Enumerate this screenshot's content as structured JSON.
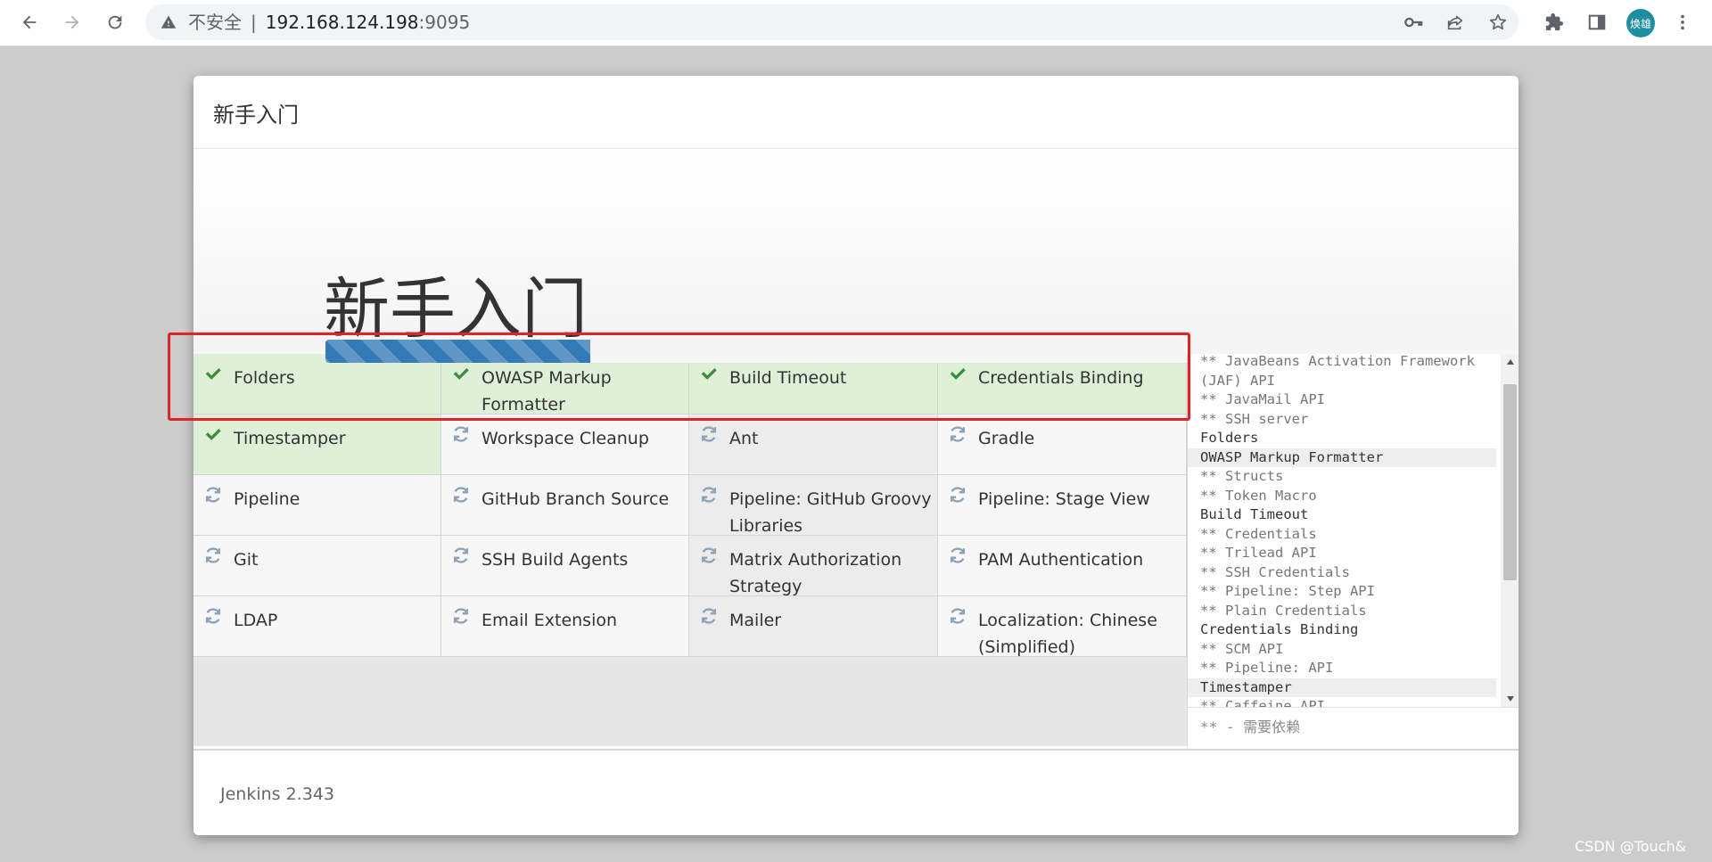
{
  "browser": {
    "security_label": "不安全",
    "separator": "|",
    "host": "192.168.124.198",
    "port": ":9095",
    "avatar_text": "焕雄",
    "icons": [
      "back-icon",
      "forward-icon",
      "reload-icon",
      "warning-icon",
      "key-icon",
      "share-icon",
      "star-icon",
      "extensions-icon",
      "side-panel-icon",
      "menu-icon"
    ]
  },
  "dialog": {
    "header_title": "新手入门",
    "hero_title": "新手入门",
    "progress_percent": 25,
    "version": "Jenkins 2.343"
  },
  "plugins": [
    {
      "name": "Folders",
      "status": "installed"
    },
    {
      "name": "OWASP Markup Formatter",
      "status": "installed"
    },
    {
      "name": "Build Timeout",
      "status": "installed"
    },
    {
      "name": "Credentials Binding",
      "status": "installed"
    },
    {
      "name": "Timestamper",
      "status": "installed"
    },
    {
      "name": "Workspace Cleanup",
      "status": "pending"
    },
    {
      "name": "Ant",
      "status": "pending"
    },
    {
      "name": "Gradle",
      "status": "pending"
    },
    {
      "name": "Pipeline",
      "status": "pending"
    },
    {
      "name": "GitHub Branch Source",
      "status": "pending"
    },
    {
      "name": "Pipeline: GitHub Groovy Libraries",
      "status": "pending"
    },
    {
      "name": "Pipeline: Stage View",
      "status": "pending"
    },
    {
      "name": "Git",
      "status": "pending"
    },
    {
      "name": "SSH Build Agents",
      "status": "pending"
    },
    {
      "name": "Matrix Authorization Strategy",
      "status": "pending"
    },
    {
      "name": "PAM Authentication",
      "status": "pending"
    },
    {
      "name": "LDAP",
      "status": "pending"
    },
    {
      "name": "Email Extension",
      "status": "pending"
    },
    {
      "name": "Mailer",
      "status": "pending"
    },
    {
      "name": "Localization: Chinese (Simplified)",
      "status": "pending"
    }
  ],
  "log": {
    "lines": [
      {
        "text": "** JavaBeans Activation Framework",
        "type": "dep"
      },
      {
        "text": "(JAF) API",
        "type": "dep"
      },
      {
        "text": "** JavaMail API",
        "type": "dep"
      },
      {
        "text": "** SSH server",
        "type": "dep"
      },
      {
        "text": "Folders",
        "type": "plugin"
      },
      {
        "text": "OWASP Markup Formatter",
        "type": "plugin-hl"
      },
      {
        "text": "** Structs",
        "type": "dep"
      },
      {
        "text": "** Token Macro",
        "type": "dep"
      },
      {
        "text": "Build Timeout",
        "type": "plugin"
      },
      {
        "text": "** Credentials",
        "type": "dep"
      },
      {
        "text": "** Trilead API",
        "type": "dep"
      },
      {
        "text": "** SSH Credentials",
        "type": "dep"
      },
      {
        "text": "** Pipeline: Step API",
        "type": "dep"
      },
      {
        "text": "** Plain Credentials",
        "type": "dep"
      },
      {
        "text": "Credentials Binding",
        "type": "plugin"
      },
      {
        "text": "** SCM API",
        "type": "dep"
      },
      {
        "text": "** Pipeline: API",
        "type": "dep"
      },
      {
        "text": "Timestamper",
        "type": "plugin-hl"
      },
      {
        "text": "** Caffeine API",
        "type": "dep"
      }
    ],
    "legend": "** - 需要依赖"
  },
  "watermark": "CSDN @Touch&",
  "colors": {
    "installed_bg": "#dff0d8",
    "check": "#3c8c3c",
    "pending_icon": "#8fa3b8",
    "progress": "#337ab7",
    "annotation": "#e02424"
  }
}
